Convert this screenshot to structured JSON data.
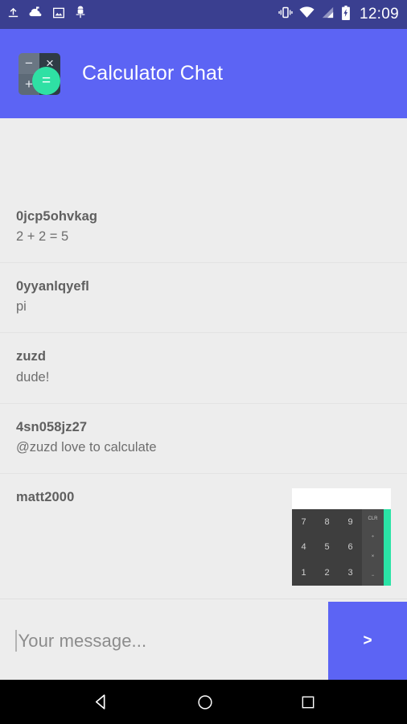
{
  "statusbar": {
    "left_icons": [
      "upload-icon",
      "cloud-upload-icon",
      "image-icon",
      "android-debug-icon"
    ],
    "right_icons": [
      "vibrate-icon",
      "wifi-icon",
      "signal-icon",
      "battery-charging-icon"
    ],
    "time": "12:09"
  },
  "appbar": {
    "title": "Calculator Chat",
    "logo": {
      "name": "calculator-app-icon",
      "keys": [
        "−",
        "×",
        "+",
        ""
      ],
      "equals": "=",
      "accent_color": "#2fe0a4",
      "bar_color": "#5c64f4"
    }
  },
  "messages": [
    {
      "author": "0jcp5ohvkag",
      "text": "2 + 2 = 5",
      "has_image": false
    },
    {
      "author": "0yyanlqyefl",
      "text": "pi",
      "has_image": false
    },
    {
      "author": "zuzd",
      "text": "dude!",
      "has_image": false
    },
    {
      "author": "4sn058jz27",
      "text": "@zuzd love to calculate",
      "has_image": false
    },
    {
      "author": "matt2000",
      "text": "",
      "has_image": true
    }
  ],
  "attachment": {
    "name": "calculator-screenshot",
    "digits": [
      "7",
      "8",
      "9",
      "4",
      "5",
      "6",
      "1",
      "2",
      "3"
    ],
    "operators": [
      "CLR",
      "÷",
      "×",
      "−"
    ],
    "display_value": "",
    "keypad_color": "#3e3e3e",
    "operator_color": "#4b4b4b",
    "accent_color": "#2ae3a6"
  },
  "composer": {
    "placeholder": "Your message...",
    "value": "",
    "send_label": ">"
  },
  "navbar": {
    "back": "back-icon",
    "home": "home-icon",
    "recents": "recents-icon"
  }
}
